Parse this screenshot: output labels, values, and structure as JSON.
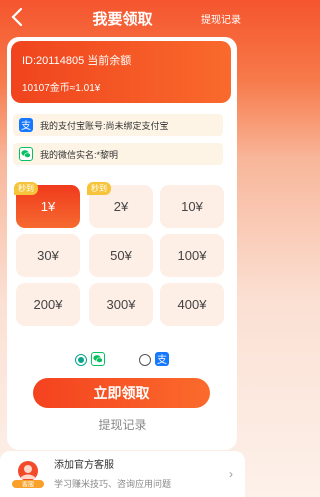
{
  "header": {
    "title": "我要领取",
    "record_link": "提现记录"
  },
  "balance": {
    "line1": "ID:20114805 当前余额",
    "line2": "10107金币≈1.01¥"
  },
  "accounts": {
    "alipay": "我的支付宝账号:尚未绑定支付宝",
    "wechat": "我的微信实名:*黎明"
  },
  "amounts": [
    {
      "label": "1¥",
      "tag": "秒到",
      "selected": true
    },
    {
      "label": "2¥",
      "tag": "秒到",
      "selected": false
    },
    {
      "label": "10¥",
      "tag": "",
      "selected": false
    },
    {
      "label": "30¥",
      "tag": "",
      "selected": false
    },
    {
      "label": "50¥",
      "tag": "",
      "selected": false
    },
    {
      "label": "100¥",
      "tag": "",
      "selected": false
    },
    {
      "label": "200¥",
      "tag": "",
      "selected": false
    },
    {
      "label": "300¥",
      "tag": "",
      "selected": false
    },
    {
      "label": "400¥",
      "tag": "",
      "selected": false
    }
  ],
  "method": {
    "selected": "wechat"
  },
  "buttons": {
    "submit": "立即领取",
    "record": "提现记录"
  },
  "service": {
    "title": "添加官方客服",
    "subtitle": "学习赚米技巧、咨询应用问题",
    "badge": "客服"
  },
  "colors": {
    "accent": "#f4421f",
    "tag": "#f6c43a",
    "wechat": "#07c160",
    "alipay": "#1677ff"
  }
}
